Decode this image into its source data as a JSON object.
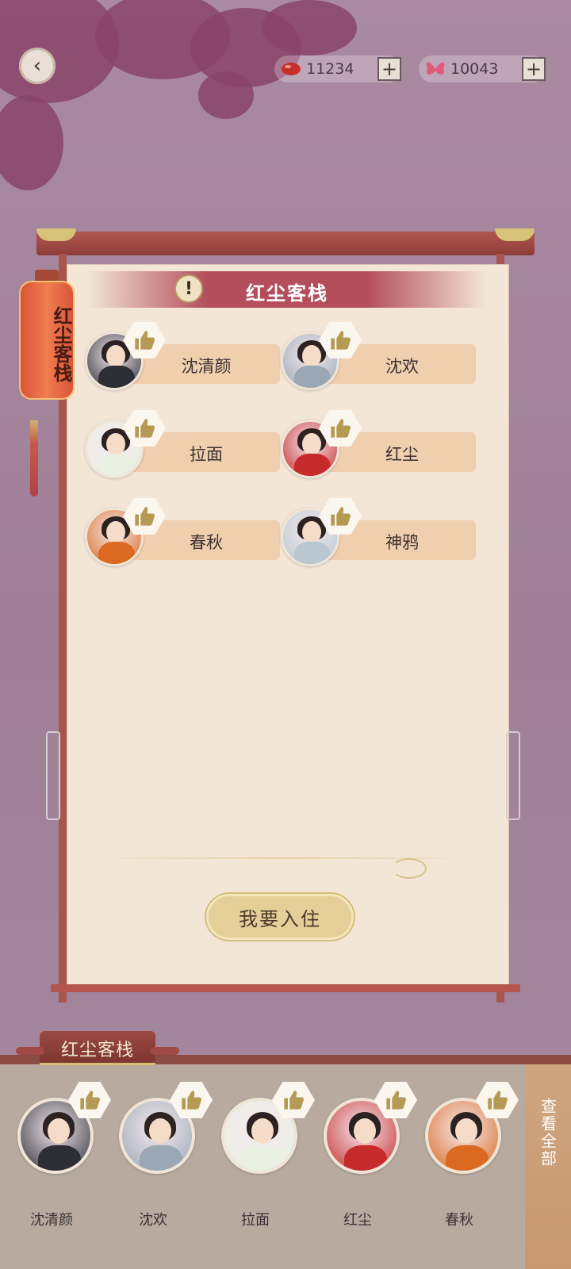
{
  "currencies": [
    {
      "icon": "red-bean-icon",
      "value": "11234"
    },
    {
      "icon": "butterfly-icon",
      "value": "10043"
    }
  ],
  "panel": {
    "title": "红尘客栈",
    "checkin_label": "我要入住"
  },
  "lantern": {
    "label": "红尘客栈"
  },
  "characters": [
    {
      "name": "沈清颜",
      "color": "#2d2d36"
    },
    {
      "name": "沈欢",
      "color": "#9aa7b5"
    },
    {
      "name": "拉面",
      "color": "#e9f0e2"
    },
    {
      "name": "红尘",
      "color": "#c72a2a"
    },
    {
      "name": "春秋",
      "color": "#d96a20"
    },
    {
      "name": "神鸦",
      "color": "#b8c6cf"
    }
  ],
  "bottom": {
    "tab_label": "红尘客栈",
    "view_all_label": "查看全部",
    "characters": [
      {
        "name": "沈清颜",
        "color": "#2d2d36"
      },
      {
        "name": "沈欢",
        "color": "#9aa7b5"
      },
      {
        "name": "拉面",
        "color": "#e9f0e2"
      },
      {
        "name": "红尘",
        "color": "#c72a2a"
      },
      {
        "name": "春秋",
        "color": "#d96a20"
      }
    ]
  }
}
